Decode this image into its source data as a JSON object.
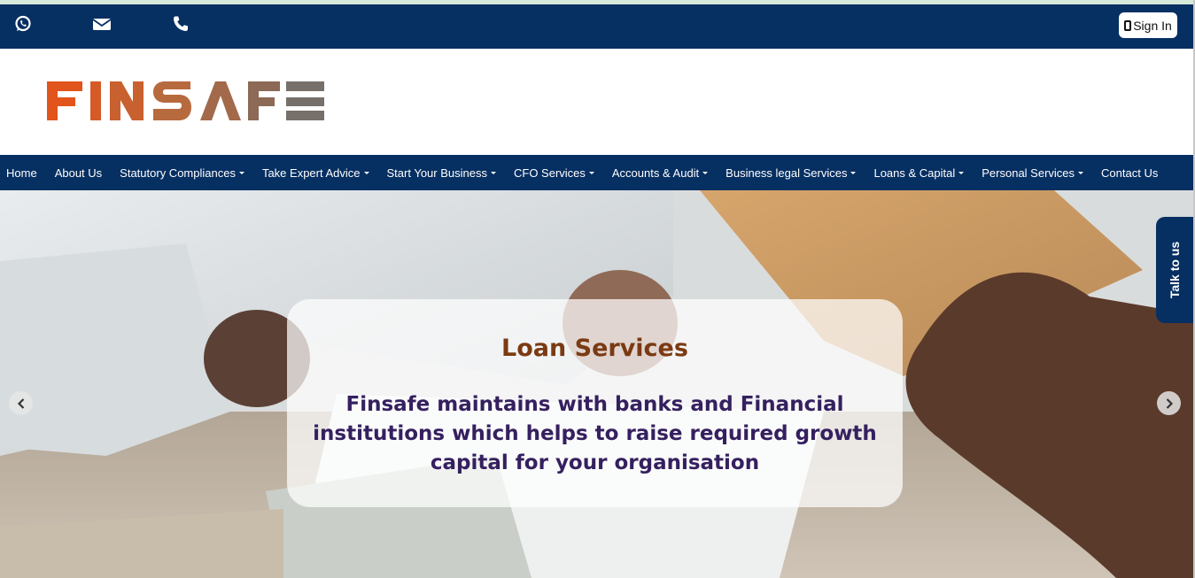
{
  "topbar": {
    "icons": [
      "whatsapp-icon",
      "mail-icon",
      "phone-icon"
    ],
    "sign_in_label": "Sign In"
  },
  "logo": {
    "text": "FINSAFE",
    "colors": [
      "#e1541b",
      "#b86a3f",
      "#7a6d63"
    ]
  },
  "nav": {
    "items": [
      {
        "label": "Home",
        "dropdown": false
      },
      {
        "label": "About Us",
        "dropdown": false
      },
      {
        "label": "Statutory Compliances",
        "dropdown": true
      },
      {
        "label": "Take Expert Advice",
        "dropdown": true
      },
      {
        "label": "Start Your Business",
        "dropdown": true
      },
      {
        "label": "CFO Services",
        "dropdown": true
      },
      {
        "label": "Accounts & Audit",
        "dropdown": true
      },
      {
        "label": "Business legal Services",
        "dropdown": true
      },
      {
        "label": "Loans & Capital",
        "dropdown": true
      },
      {
        "label": "Personal Services",
        "dropdown": true
      },
      {
        "label": "Contact Us",
        "dropdown": false
      }
    ]
  },
  "hero": {
    "title": "Loan Services",
    "text": "Finsafe maintains with banks and Financial institutions which helps to raise required growth capital for your organisation",
    "prev_icon": "chevron-left-icon",
    "next_icon": "chevron-right-icon"
  },
  "talk_tab": {
    "label": "Talk to us"
  },
  "colors": {
    "navy": "#062f62",
    "title": "#7b3a12",
    "text": "#35205f"
  }
}
